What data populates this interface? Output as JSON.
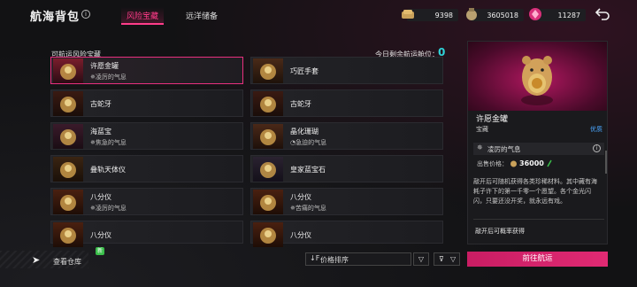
{
  "header": {
    "title": "航海背包",
    "tabs": [
      {
        "label": "风险宝藏",
        "active": true
      },
      {
        "label": "远洋储备",
        "active": false
      }
    ],
    "currencies": [
      {
        "icon": "gold-bar-icon",
        "value": "9398"
      },
      {
        "icon": "coin-bag-icon",
        "value": "3605018"
      },
      {
        "icon": "pink-gem-icon",
        "value": "11287"
      }
    ]
  },
  "list": {
    "title": "可航运风险宝藏",
    "remaining_label": "今日剩余航运舱位：",
    "remaining_value": "0",
    "items": [
      {
        "name": "许愿金罐",
        "sub": "凌厉的气息",
        "sub_icon": "✵",
        "selected": true
      },
      {
        "name": "巧匠手套",
        "sub": ""
      },
      {
        "name": "古蛇牙",
        "sub": ""
      },
      {
        "name": "古蛇牙",
        "sub": ""
      },
      {
        "name": "海蓝宝",
        "sub": "焦急的气息",
        "sub_icon": "✵"
      },
      {
        "name": "晶化珊瑚",
        "sub": "急迫的气息",
        "sub_icon": "◔"
      },
      {
        "name": "叠轨天体仪",
        "sub": ""
      },
      {
        "name": "皇家蓝宝石",
        "sub": ""
      },
      {
        "name": "八分仪",
        "sub": "凌厉的气息",
        "sub_icon": "✵"
      },
      {
        "name": "八分仪",
        "sub": "苦痛的气息",
        "sub_icon": "✵"
      },
      {
        "name": "八分仪",
        "sub": ""
      },
      {
        "name": "八分仪",
        "sub": ""
      }
    ]
  },
  "bottom": {
    "warehouse_label": "查看仓库",
    "badge": "新",
    "sort_label": "价格排序",
    "sort_icon": "↓F",
    "dropdown_icon": "▽",
    "filter_icon": "⊽",
    "filter_icon2": "▽"
  },
  "detail": {
    "name": "许愿金罐",
    "type": "宝藏",
    "rarity": "优质",
    "aura": "凌厉的气息",
    "price_label": "出售价格：",
    "price": "36000",
    "description": "敲开后可随机获得各类珍稀材料。其中藏有海耗子许下的第一千零一个愿望。各个金光闪闪，只要还没开奖，就永远有戏。",
    "source_title": "敲开后可概率获得",
    "go_button": "前往航运"
  },
  "colors": {
    "accent": "#e8307f",
    "teal": "#2fd3d8",
    "rarity_blue": "#4aa7ff"
  }
}
